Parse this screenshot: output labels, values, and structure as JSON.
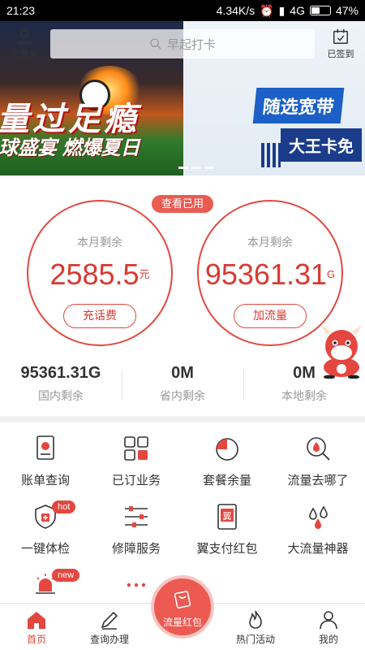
{
  "status_bar": {
    "time": "21:23",
    "speed": "4.34K/s",
    "network": "4G",
    "battery": "47%"
  },
  "header": {
    "login_label": "已登录",
    "search_placeholder": "早起打卡",
    "signin_label": "已签到"
  },
  "banner": {
    "left_headline": "量过足瘾",
    "left_subline": "球盛宴 燃爆夏日",
    "right_tag1": "随选宽带",
    "right_tag2": "大王卡免"
  },
  "balance": {
    "view_used_label": "查看已用",
    "left": {
      "caption": "本月剩余",
      "value": "2585.5",
      "unit": "元",
      "button": "充话费"
    },
    "right": {
      "caption": "本月剩余",
      "value": "95361.31",
      "unit": "G",
      "button": "加流量"
    }
  },
  "stats": [
    {
      "value": "95361.31G",
      "label": "国内剩余"
    },
    {
      "value": "0M",
      "label": "省内剩余"
    },
    {
      "value": "0M",
      "label": "本地剩余"
    }
  ],
  "grid": [
    {
      "label": "账单查询",
      "icon": "bill-icon"
    },
    {
      "label": "已订业务",
      "icon": "grid-icon"
    },
    {
      "label": "套餐余量",
      "icon": "pie-icon"
    },
    {
      "label": "流量去哪了",
      "icon": "search-drop-icon"
    },
    {
      "label": "一键体检",
      "icon": "shield-icon",
      "badge": "hot"
    },
    {
      "label": "修障服务",
      "icon": "sliders-icon"
    },
    {
      "label": "翼支付红包",
      "icon": "envelope-icon",
      "glyph": "翼"
    },
    {
      "label": "大流量神器",
      "icon": "drops-icon"
    },
    {
      "label": "",
      "icon": "alarm-icon",
      "badge": "new"
    },
    {
      "label": "",
      "icon": "more-icon"
    }
  ],
  "bottom_nav": {
    "home": "首页",
    "query": "查询办理",
    "fab": "流量红包",
    "hot": "热门活动",
    "mine": "我的"
  },
  "colors": {
    "accent": "#e3473f",
    "accent_light": "#ec5a52"
  }
}
